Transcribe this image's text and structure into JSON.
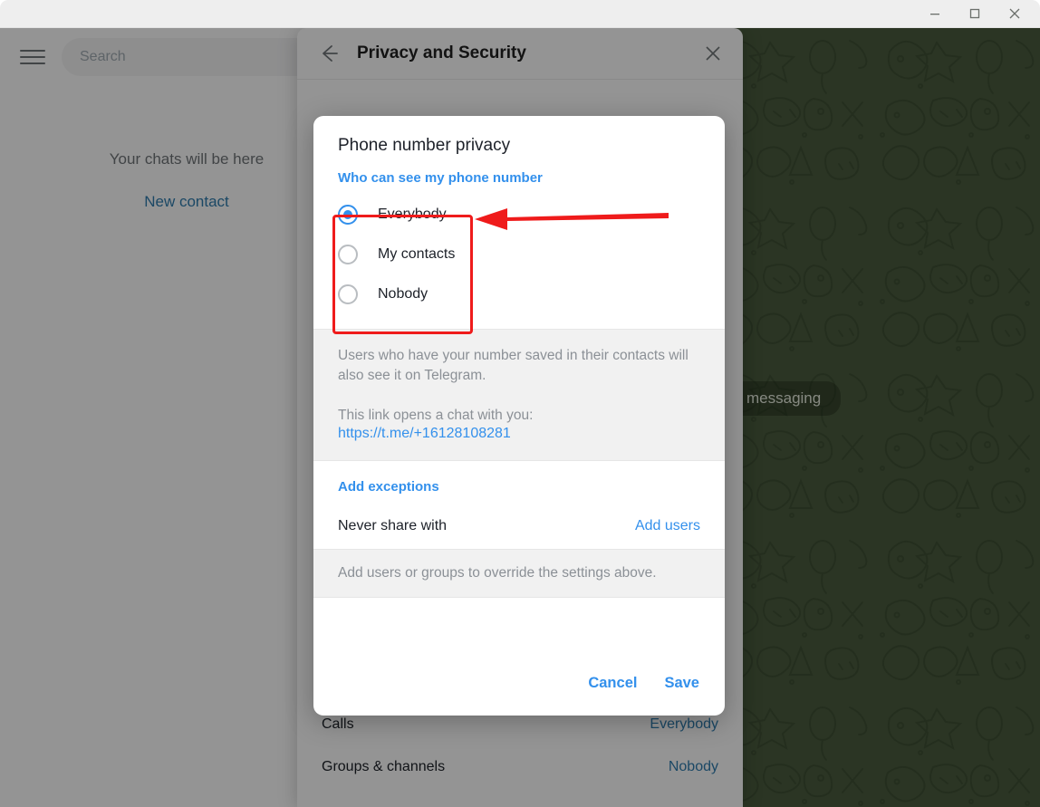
{
  "window": {
    "controls": [
      {
        "name": "minimize",
        "glyph": "minimize-icon"
      },
      {
        "name": "maximize",
        "glyph": "maximize-icon"
      },
      {
        "name": "close",
        "glyph": "close-icon"
      }
    ]
  },
  "sidebar": {
    "menu_icon": "hamburger-menu-icon",
    "search_placeholder": "Search",
    "empty_text": "Your chats will be here",
    "new_contact_label": "New contact"
  },
  "chat": {
    "badge_text": "messaging",
    "wallpaper_color": "#4a5c3e"
  },
  "settings_panel": {
    "back_icon": "arrow-left-icon",
    "title": "Privacy and Security",
    "close_icon": "close-icon",
    "rows": [
      {
        "label": "Calls",
        "value": "Everybody"
      },
      {
        "label": "Groups & channels",
        "value": "Nobody"
      }
    ]
  },
  "modal": {
    "title": "Phone number privacy",
    "section_heading": "Who can see my phone number",
    "options": [
      {
        "label": "Everybody",
        "selected": true
      },
      {
        "label": "My contacts",
        "selected": false
      },
      {
        "label": "Nobody",
        "selected": false
      }
    ],
    "info_text": "Users who have your number saved in their contacts will also see it on Telegram.",
    "link_intro": "This link opens a chat with you:",
    "link_url": "https://t.me/+16128108281",
    "exceptions_heading": "Add exceptions",
    "exception_row": {
      "label": "Never share with",
      "action": "Add users"
    },
    "exceptions_hint": "Add users or groups to override the settings above.",
    "cancel_label": "Cancel",
    "save_label": "Save"
  },
  "annotation": {
    "color": "#ef1b1b",
    "highlight_target": "radio-option-group",
    "arrow_direction": "left"
  },
  "colors": {
    "accent": "#3390ec",
    "link": "#2f7caf",
    "muted": "#8b9096",
    "annotation": "#ef1b1b"
  }
}
